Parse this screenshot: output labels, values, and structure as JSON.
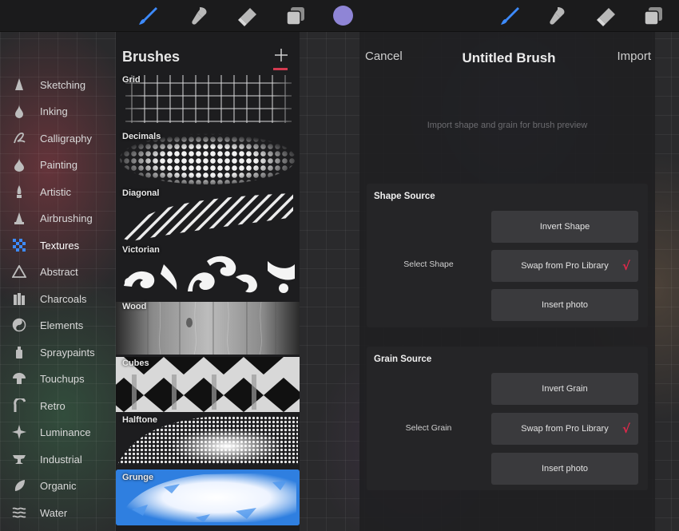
{
  "toolbar_left": [
    {
      "name": "brush-icon",
      "color": "#3d8bff"
    },
    {
      "name": "smudge-icon",
      "color": "#b8b8b8"
    },
    {
      "name": "eraser-icon",
      "color": "#b8b8b8"
    },
    {
      "name": "layers-icon",
      "color": "#b8b8b8"
    }
  ],
  "current_color": "#8f85d6",
  "toolbar_right": [
    {
      "name": "brush-icon",
      "color": "#3d8bff"
    },
    {
      "name": "smudge-icon",
      "color": "#b8b8b8"
    },
    {
      "name": "eraser-icon",
      "color": "#b8b8b8"
    },
    {
      "name": "layers-icon",
      "color": "#b8b8b8"
    }
  ],
  "categories": [
    {
      "label": "Sketching",
      "icon": "pencil-tip-icon"
    },
    {
      "label": "Inking",
      "icon": "ink-drop-icon"
    },
    {
      "label": "Calligraphy",
      "icon": "calligraphy-stroke-icon"
    },
    {
      "label": "Painting",
      "icon": "paint-drop-icon"
    },
    {
      "label": "Artistic",
      "icon": "brush-tip-icon"
    },
    {
      "label": "Airbrushing",
      "icon": "airbrush-icon"
    },
    {
      "label": "Textures",
      "icon": "checker-icon",
      "active": true
    },
    {
      "label": "Abstract",
      "icon": "triangle-icon"
    },
    {
      "label": "Charcoals",
      "icon": "charcoal-sticks-icon"
    },
    {
      "label": "Elements",
      "icon": "yin-yang-icon"
    },
    {
      "label": "Spraypaints",
      "icon": "spray-can-icon"
    },
    {
      "label": "Touchups",
      "icon": "mushroom-icon"
    },
    {
      "label": "Retro",
      "icon": "retro-arc-icon"
    },
    {
      "label": "Luminance",
      "icon": "sparkle-icon"
    },
    {
      "label": "Industrial",
      "icon": "anvil-icon"
    },
    {
      "label": "Organic",
      "icon": "leaf-icon"
    },
    {
      "label": "Water",
      "icon": "waves-icon"
    }
  ],
  "brushes_panel": {
    "title": "Brushes",
    "add_label": "+",
    "accent": "#d33a50",
    "items": [
      {
        "label": "Grid"
      },
      {
        "label": "Decimals"
      },
      {
        "label": "Diagonal"
      },
      {
        "label": "Victorian"
      },
      {
        "label": "Wood"
      },
      {
        "label": "Cubes"
      },
      {
        "label": "Halftone"
      },
      {
        "label": "Grunge",
        "selected": true
      }
    ]
  },
  "studio": {
    "cancel_label": "Cancel",
    "title": "Untitled Brush",
    "import_label": "Import",
    "preview_hint": "Import shape and grain for brush preview",
    "shape": {
      "title": "Shape Source",
      "select_label": "Select Shape",
      "invert_label": "Invert Shape",
      "swap_label": "Swap from Pro Library",
      "insert_label": "Insert photo",
      "checkmark": "√"
    },
    "grain": {
      "title": "Grain Source",
      "select_label": "Select Grain",
      "invert_label": "Invert Grain",
      "swap_label": "Swap from Pro Library",
      "insert_label": "Insert photo",
      "checkmark": "√"
    },
    "checkmark_color": "#e0284a"
  }
}
